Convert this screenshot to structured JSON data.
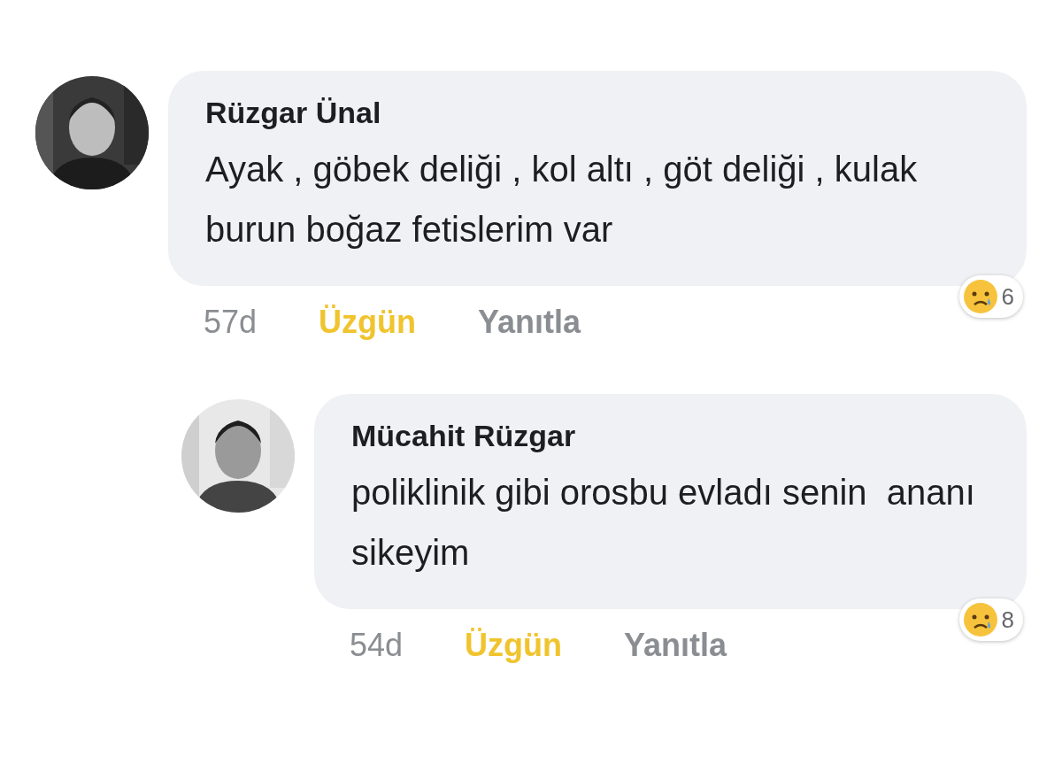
{
  "comments": [
    {
      "author": "Rüzgar Ünal",
      "text": "Ayak , göbek deliği , kol altı , göt deliği , kulak burun boğaz fetislerim var",
      "time": "57d",
      "reaction_label": "Üzgün",
      "reacted": true,
      "reply_label": "Yanıtla",
      "reaction_count": "6",
      "replies": [
        {
          "author": "Mücahit Rüzgar",
          "text": "poliklinik gibi orosbu evladı senin  ananı sikeyim",
          "time": "54d",
          "reaction_label": "Üzgün",
          "reacted": true,
          "reply_label": "Yanıtla",
          "reaction_count": "8"
        }
      ]
    }
  ]
}
